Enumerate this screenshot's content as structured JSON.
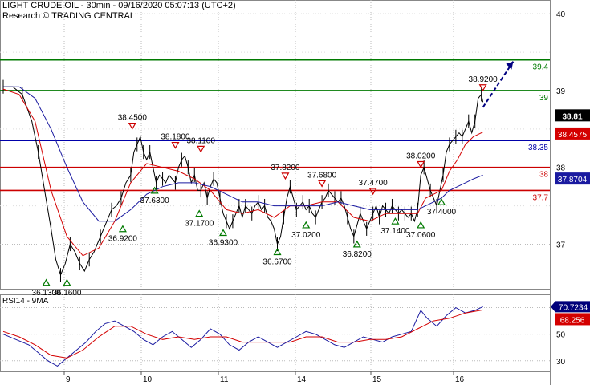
{
  "header": {
    "title": "LIGHT CRUDE OIL - 30min - 09/16/2020 05:07:13 (UTC+2)",
    "research": "Research © TRADING CENTRAL"
  },
  "rsi_panel": {
    "label": "RSI14 - 9MA",
    "value_label": "70.7234",
    "ma_label": "68.256",
    "ticks": [
      "70",
      "50",
      "30"
    ]
  },
  "colors": {
    "price": "#000000",
    "ma_fast": "#d40000",
    "ma_slow": "#1a1aa0",
    "green_level": "#007a00",
    "blue_level": "#0000aa",
    "red_level": "#cc0000",
    "arrow": "#000080"
  },
  "chart_data": {
    "type": "line",
    "x_labels": [
      "9",
      "10",
      "11",
      "14",
      "15",
      "16"
    ],
    "y_ticks": [
      37,
      38,
      39,
      40
    ],
    "ylim": [
      36.42,
      40.18
    ],
    "price_tag": "38.81",
    "levels": [
      {
        "price": 39.4,
        "label": "39.4",
        "color": "#007a00"
      },
      {
        "price": 39.0,
        "label": "39",
        "color": "#007a00"
      },
      {
        "price": 38.35,
        "label": "38.35",
        "color": "#0000aa"
      },
      {
        "price": 38.0,
        "label": "38",
        "color": "#cc0000"
      },
      {
        "price": 37.7,
        "label": "37.7",
        "color": "#cc0000"
      }
    ],
    "ma_tags": [
      {
        "value": 38.4575,
        "label": "38.4575",
        "color": "#d40000"
      },
      {
        "value": 37.8704,
        "label": "37.8704",
        "color": "#1a1aa0"
      }
    ],
    "price_path": [
      [
        0,
        39.05
      ],
      [
        6,
        39.05
      ],
      [
        12,
        38.95
      ],
      [
        18,
        38.6
      ],
      [
        22,
        38.2
      ],
      [
        26,
        37.7
      ],
      [
        30,
        37.2
      ],
      [
        33,
        36.8
      ],
      [
        36,
        36.6
      ],
      [
        39,
        36.75
      ],
      [
        42,
        37.0
      ],
      [
        45,
        36.9
      ],
      [
        48,
        36.75
      ],
      [
        51,
        36.65
      ],
      [
        54,
        36.8
      ],
      [
        57,
        36.9
      ],
      [
        61,
        37.1
      ],
      [
        65,
        37.3
      ],
      [
        68,
        37.45
      ],
      [
        71,
        37.5
      ],
      [
        74,
        37.6
      ],
      [
        77,
        37.8
      ],
      [
        80,
        37.9
      ],
      [
        82,
        38.2
      ],
      [
        84,
        38.3
      ],
      [
        86,
        38.4
      ],
      [
        88,
        38.2
      ],
      [
        90,
        38.1
      ],
      [
        92,
        38.2
      ],
      [
        94,
        38.0
      ],
      [
        96,
        37.8
      ],
      [
        98,
        37.9
      ],
      [
        100,
        37.85
      ],
      [
        102,
        37.8
      ],
      [
        104,
        37.9
      ],
      [
        106,
        37.85
      ],
      [
        108,
        37.8
      ],
      [
        110,
        38.0
      ],
      [
        112,
        38.1
      ],
      [
        114,
        38.15
      ],
      [
        116,
        38.0
      ],
      [
        118,
        37.8
      ],
      [
        120,
        37.9
      ],
      [
        122,
        37.7
      ],
      [
        124,
        37.7
      ],
      [
        126,
        37.8
      ],
      [
        128,
        37.6
      ],
      [
        130,
        37.75
      ],
      [
        132,
        37.85
      ],
      [
        134,
        37.8
      ],
      [
        136,
        37.6
      ],
      [
        138,
        37.4
      ],
      [
        140,
        37.3
      ],
      [
        142,
        37.2
      ],
      [
        144,
        37.3
      ],
      [
        146,
        37.4
      ],
      [
        148,
        37.5
      ],
      [
        150,
        37.35
      ],
      [
        152,
        37.5
      ],
      [
        154,
        37.45
      ],
      [
        156,
        37.4
      ],
      [
        158,
        37.5
      ],
      [
        160,
        37.55
      ],
      [
        162,
        37.45
      ],
      [
        164,
        37.5
      ],
      [
        166,
        37.35
      ],
      [
        168,
        37.3
      ],
      [
        170,
        37.2
      ],
      [
        172,
        37.0
      ],
      [
        174,
        37.1
      ],
      [
        176,
        37.35
      ],
      [
        178,
        37.6
      ],
      [
        180,
        37.75
      ],
      [
        182,
        37.6
      ],
      [
        184,
        37.45
      ],
      [
        186,
        37.5
      ],
      [
        188,
        37.55
      ],
      [
        190,
        37.45
      ],
      [
        192,
        37.5
      ],
      [
        194,
        37.4
      ],
      [
        196,
        37.35
      ],
      [
        198,
        37.45
      ],
      [
        200,
        37.55
      ],
      [
        202,
        37.6
      ],
      [
        204,
        37.7
      ],
      [
        206,
        37.65
      ],
      [
        208,
        37.6
      ],
      [
        210,
        37.55
      ],
      [
        212,
        37.6
      ],
      [
        214,
        37.5
      ],
      [
        216,
        37.35
      ],
      [
        218,
        37.2
      ],
      [
        220,
        37.1
      ],
      [
        222,
        37.25
      ],
      [
        224,
        37.4
      ],
      [
        226,
        37.3
      ],
      [
        228,
        37.2
      ],
      [
        230,
        37.3
      ],
      [
        232,
        37.4
      ],
      [
        234,
        37.5
      ],
      [
        236,
        37.35
      ],
      [
        238,
        37.5
      ],
      [
        240,
        37.45
      ],
      [
        242,
        37.4
      ],
      [
        244,
        37.5
      ],
      [
        246,
        37.45
      ],
      [
        248,
        37.4
      ],
      [
        250,
        37.45
      ],
      [
        252,
        37.4
      ],
      [
        254,
        37.35
      ],
      [
        256,
        37.4
      ],
      [
        258,
        37.3
      ],
      [
        260,
        37.45
      ],
      [
        262,
        37.9
      ],
      [
        264,
        38.0
      ],
      [
        266,
        37.85
      ],
      [
        268,
        37.7
      ],
      [
        270,
        37.6
      ],
      [
        272,
        37.5
      ],
      [
        274,
        37.7
      ],
      [
        276,
        37.9
      ],
      [
        278,
        38.2
      ],
      [
        280,
        38.3
      ],
      [
        282,
        38.35
      ],
      [
        284,
        38.4
      ],
      [
        286,
        38.45
      ],
      [
        288,
        38.4
      ],
      [
        290,
        38.5
      ],
      [
        292,
        38.6
      ],
      [
        294,
        38.45
      ],
      [
        296,
        38.6
      ],
      [
        298,
        38.9
      ],
      [
        300,
        38.95
      ],
      [
        301,
        38.85
      ]
    ],
    "ma_fast_path": [
      [
        0,
        39.02
      ],
      [
        10,
        38.95
      ],
      [
        20,
        38.6
      ],
      [
        30,
        37.7
      ],
      [
        40,
        37.1
      ],
      [
        50,
        36.85
      ],
      [
        60,
        36.95
      ],
      [
        70,
        37.3
      ],
      [
        80,
        37.8
      ],
      [
        90,
        38.05
      ],
      [
        100,
        38.0
      ],
      [
        110,
        37.95
      ],
      [
        120,
        37.85
      ],
      [
        130,
        37.7
      ],
      [
        140,
        37.45
      ],
      [
        150,
        37.4
      ],
      [
        160,
        37.45
      ],
      [
        170,
        37.35
      ],
      [
        180,
        37.5
      ],
      [
        190,
        37.5
      ],
      [
        200,
        37.55
      ],
      [
        210,
        37.55
      ],
      [
        220,
        37.35
      ],
      [
        230,
        37.3
      ],
      [
        240,
        37.4
      ],
      [
        250,
        37.4
      ],
      [
        260,
        37.4
      ],
      [
        265,
        37.6
      ],
      [
        270,
        37.65
      ],
      [
        275,
        37.7
      ],
      [
        280,
        37.95
      ],
      [
        285,
        38.1
      ],
      [
        290,
        38.3
      ],
      [
        295,
        38.4
      ],
      [
        301,
        38.46
      ]
    ],
    "ma_slow_path": [
      [
        0,
        39.05
      ],
      [
        10,
        39.05
      ],
      [
        20,
        38.9
      ],
      [
        30,
        38.5
      ],
      [
        40,
        38.0
      ],
      [
        50,
        37.55
      ],
      [
        60,
        37.3
      ],
      [
        70,
        37.3
      ],
      [
        80,
        37.45
      ],
      [
        90,
        37.65
      ],
      [
        100,
        37.75
      ],
      [
        110,
        37.8
      ],
      [
        120,
        37.8
      ],
      [
        130,
        37.75
      ],
      [
        140,
        37.65
      ],
      [
        150,
        37.55
      ],
      [
        160,
        37.55
      ],
      [
        170,
        37.5
      ],
      [
        180,
        37.5
      ],
      [
        190,
        37.5
      ],
      [
        200,
        37.5
      ],
      [
        210,
        37.55
      ],
      [
        220,
        37.5
      ],
      [
        230,
        37.45
      ],
      [
        240,
        37.45
      ],
      [
        250,
        37.45
      ],
      [
        260,
        37.45
      ],
      [
        265,
        37.5
      ],
      [
        270,
        37.55
      ],
      [
        275,
        37.6
      ],
      [
        280,
        37.7
      ],
      [
        285,
        37.75
      ],
      [
        290,
        37.8
      ],
      [
        295,
        37.85
      ],
      [
        301,
        37.9
      ]
    ],
    "annotations": [
      {
        "label": "36.1300",
        "t": 27,
        "price": 36.6,
        "kind": "low"
      },
      {
        "label": "36.1600",
        "t": 40,
        "price": 36.6,
        "kind": "low"
      },
      {
        "label": "38.4500",
        "t": 81,
        "price": 38.45,
        "kind": "high"
      },
      {
        "label": "36.9200",
        "t": 75,
        "price": 37.3,
        "kind": "low"
      },
      {
        "label": "37.6300",
        "t": 95,
        "price": 37.8,
        "kind": "low"
      },
      {
        "label": "38.1800",
        "t": 108,
        "price": 38.2,
        "kind": "high"
      },
      {
        "label": "38.1100",
        "t": 124,
        "price": 38.15,
        "kind": "high"
      },
      {
        "label": "37.1700",
        "t": 123,
        "price": 37.5,
        "kind": "low"
      },
      {
        "label": "36.9300",
        "t": 138,
        "price": 37.25,
        "kind": "low"
      },
      {
        "label": "37.8200",
        "t": 177,
        "price": 37.8,
        "kind": "high"
      },
      {
        "label": "36.6700",
        "t": 172,
        "price": 37.0,
        "kind": "low"
      },
      {
        "label": "37.0200",
        "t": 190,
        "price": 37.35,
        "kind": "low"
      },
      {
        "label": "37.6800",
        "t": 200,
        "price": 37.7,
        "kind": "high"
      },
      {
        "label": "36.8200",
        "t": 222,
        "price": 37.1,
        "kind": "low"
      },
      {
        "label": "37.4700",
        "t": 232,
        "price": 37.6,
        "kind": "high"
      },
      {
        "label": "37.1400",
        "t": 246,
        "price": 37.4,
        "kind": "low"
      },
      {
        "label": "37.0600",
        "t": 262,
        "price": 37.35,
        "kind": "low"
      },
      {
        "label": "38.0200",
        "t": 262,
        "price": 37.95,
        "kind": "high"
      },
      {
        "label": "37.4000",
        "t": 275,
        "price": 37.65,
        "kind": "low"
      },
      {
        "label": "38.9200",
        "t": 301,
        "price": 38.95,
        "kind": "high"
      }
    ],
    "rsi_path": [
      [
        0,
        50
      ],
      [
        8,
        46
      ],
      [
        16,
        42
      ],
      [
        22,
        36
      ],
      [
        28,
        30
      ],
      [
        34,
        26
      ],
      [
        40,
        32
      ],
      [
        46,
        38
      ],
      [
        52,
        44
      ],
      [
        58,
        52
      ],
      [
        64,
        58
      ],
      [
        70,
        60
      ],
      [
        76,
        56
      ],
      [
        82,
        52
      ],
      [
        88,
        46
      ],
      [
        94,
        42
      ],
      [
        100,
        48
      ],
      [
        106,
        52
      ],
      [
        112,
        46
      ],
      [
        118,
        40
      ],
      [
        124,
        46
      ],
      [
        130,
        54
      ],
      [
        136,
        50
      ],
      [
        142,
        42
      ],
      [
        148,
        38
      ],
      [
        154,
        44
      ],
      [
        160,
        48
      ],
      [
        166,
        44
      ],
      [
        172,
        40
      ],
      [
        178,
        44
      ],
      [
        184,
        48
      ],
      [
        190,
        52
      ],
      [
        196,
        50
      ],
      [
        202,
        46
      ],
      [
        208,
        42
      ],
      [
        214,
        40
      ],
      [
        220,
        44
      ],
      [
        226,
        48
      ],
      [
        232,
        46
      ],
      [
        238,
        44
      ],
      [
        244,
        48
      ],
      [
        250,
        50
      ],
      [
        256,
        52
      ],
      [
        262,
        68
      ],
      [
        266,
        62
      ],
      [
        272,
        56
      ],
      [
        278,
        64
      ],
      [
        284,
        70
      ],
      [
        290,
        66
      ],
      [
        296,
        68
      ],
      [
        301,
        70.7
      ]
    ],
    "rsi_ma_path": [
      [
        0,
        52
      ],
      [
        10,
        48
      ],
      [
        20,
        42
      ],
      [
        30,
        34
      ],
      [
        40,
        32
      ],
      [
        50,
        38
      ],
      [
        60,
        48
      ],
      [
        70,
        56
      ],
      [
        80,
        56
      ],
      [
        90,
        50
      ],
      [
        100,
        46
      ],
      [
        110,
        48
      ],
      [
        120,
        46
      ],
      [
        130,
        48
      ],
      [
        140,
        48
      ],
      [
        150,
        44
      ],
      [
        160,
        44
      ],
      [
        170,
        44
      ],
      [
        180,
        44
      ],
      [
        190,
        48
      ],
      [
        200,
        48
      ],
      [
        210,
        44
      ],
      [
        220,
        44
      ],
      [
        230,
        46
      ],
      [
        240,
        46
      ],
      [
        250,
        48
      ],
      [
        260,
        54
      ],
      [
        270,
        60
      ],
      [
        280,
        62
      ],
      [
        290,
        66
      ],
      [
        301,
        68.3
      ]
    ],
    "rsi_ylim": [
      22,
      80
    ],
    "forecast_arrow": {
      "from": [
        301,
        38.95
      ],
      "to": [
        320,
        39.4
      ]
    }
  }
}
